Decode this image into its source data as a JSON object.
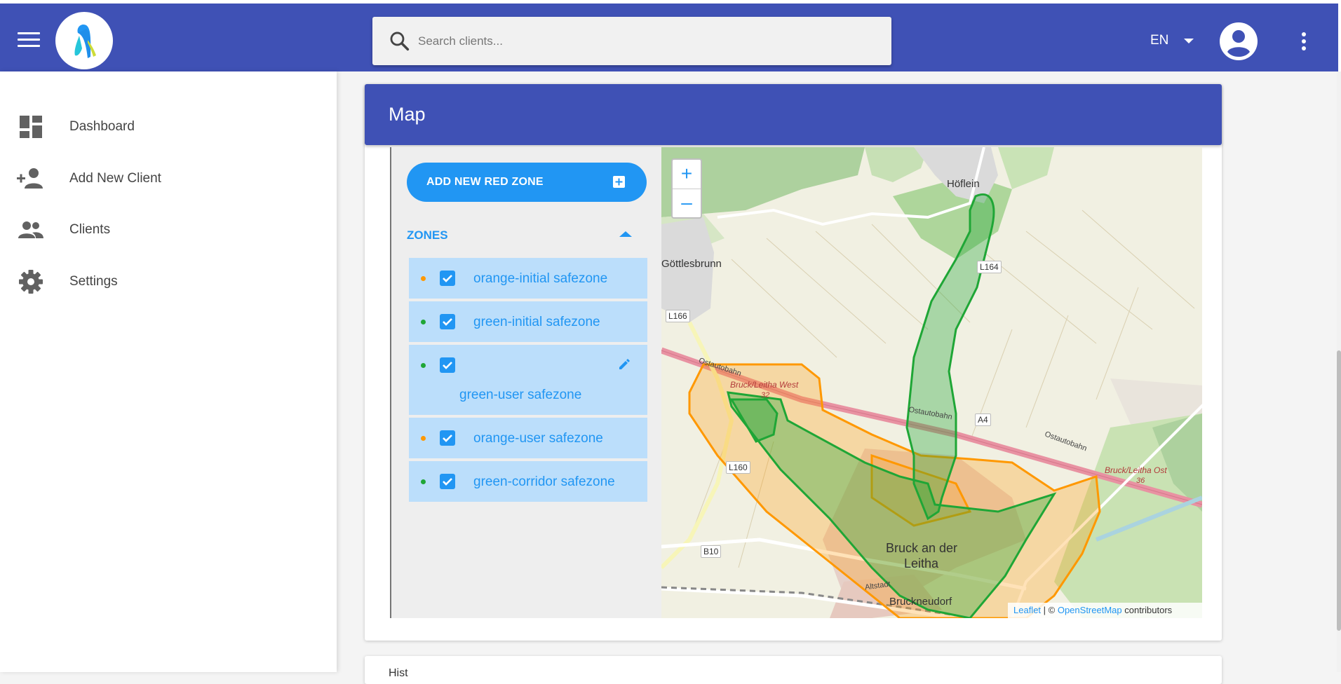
{
  "header": {
    "search_placeholder": "Search clients...",
    "language": "EN"
  },
  "sidebar": {
    "items": [
      {
        "label": "Dashboard",
        "icon": "dashboard-icon"
      },
      {
        "label": "Add New Client",
        "icon": "person-add-icon"
      },
      {
        "label": "Clients",
        "icon": "people-icon"
      },
      {
        "label": "Settings",
        "icon": "gear-icon"
      }
    ]
  },
  "map_card": {
    "title": "Map",
    "add_button": "ADD NEW RED ZONE",
    "zones_title": "ZONES",
    "zones": [
      {
        "label": "orange-initial safezone",
        "color": "#ff9800",
        "checked": true
      },
      {
        "label": "green-initial safezone",
        "color": "#1fa636",
        "checked": true
      },
      {
        "label": "green-user safezone",
        "color": "#1fa636",
        "checked": true,
        "editable": true
      },
      {
        "label": "orange-user safezone",
        "color": "#ff9800",
        "checked": true
      },
      {
        "label": "green-corridor safezone",
        "color": "#1fa636",
        "checked": true
      }
    ]
  },
  "map": {
    "zoom_in": "+",
    "zoom_out": "–",
    "attribution": {
      "leaflet": "Leaflet",
      "separator": " | © ",
      "osm": "OpenStreetMap",
      "suffix": " contributors"
    },
    "labels": {
      "hoflein": "Höflein",
      "gottlesbrunn": "Göttlesbrunn",
      "l164": "L164",
      "l166": "L166",
      "l160": "L160",
      "b10": "B10",
      "a4": "A4",
      "ostautobahn_1": "Ostautobahn",
      "ostautobahn_2": "Ostautobahn",
      "ostautobahn_3": "Ostautobahn",
      "autobahn": "Ostautobahn",
      "bruck_west": "Bruck/Leitha West",
      "bruck_west_num": "32",
      "bruck_ost": "Bruck/Leitha Ost",
      "bruck_ost_num": "36",
      "bruck_line1": "Bruck an der",
      "bruck_line2": "Leitha",
      "altstadt": "Altstadt",
      "bruckneudorf": "Bruckneudorf"
    },
    "colors": {
      "orange_zone": "#ff9800",
      "green_zone": "#1fa636",
      "header": "#3f51b5",
      "accent": "#2196f3"
    }
  },
  "history_card": {
    "title": "Hist"
  }
}
